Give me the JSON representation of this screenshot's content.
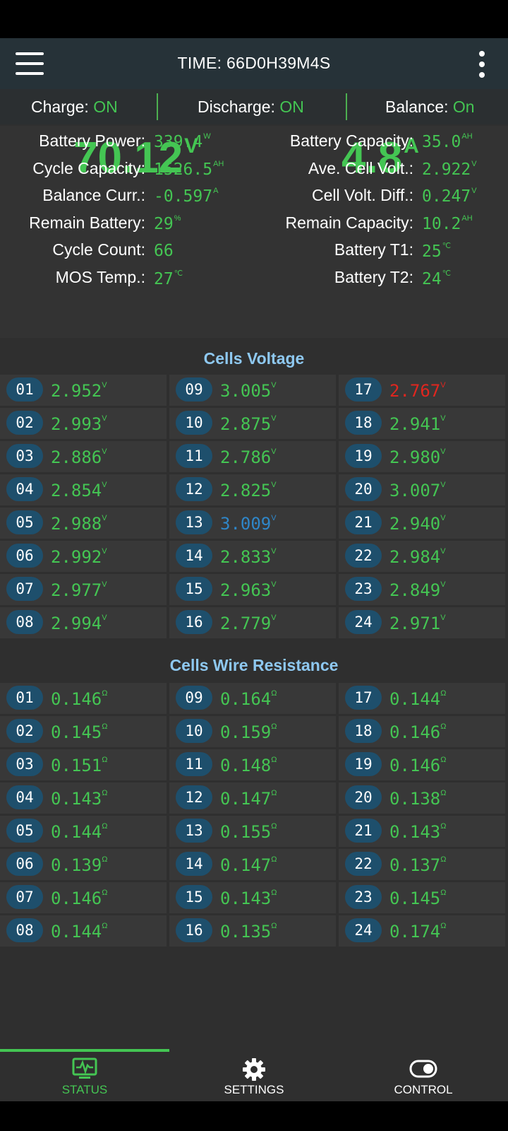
{
  "header": {
    "title": "TIME: 66D0H39M4S"
  },
  "switches": [
    {
      "label": "Charge:",
      "value": "ON"
    },
    {
      "label": "Discharge:",
      "value": "ON"
    },
    {
      "label": "Balance:",
      "value": "On"
    }
  ],
  "summary": {
    "voltage": {
      "value": "70.12",
      "unit": "V"
    },
    "current": {
      "value": "4.8",
      "unit": "A"
    },
    "left": [
      {
        "label": "Battery Power:",
        "value": "339.4",
        "unit": "W"
      },
      {
        "label": "Cycle Capacity:",
        "value": "1526.5",
        "unit": "AH"
      },
      {
        "label": "Balance Curr.:",
        "value": "-0.597",
        "unit": "A"
      },
      {
        "label": "Remain Battery:",
        "value": "29",
        "unit": "%"
      },
      {
        "label": "Cycle Count:",
        "value": "66",
        "unit": ""
      },
      {
        "label": "MOS Temp.:",
        "value": "27",
        "unit": "℃"
      }
    ],
    "right": [
      {
        "label": "Battery Capacity:",
        "value": "35.0",
        "unit": "AH"
      },
      {
        "label": "Ave. Cell Volt.:",
        "value": "2.922",
        "unit": "V"
      },
      {
        "label": "Cell Volt. Diff.:",
        "value": "0.247",
        "unit": "V"
      },
      {
        "label": "Remain Capacity:",
        "value": "10.2",
        "unit": "AH"
      },
      {
        "label": "Battery T1:",
        "value": "25",
        "unit": "℃"
      },
      {
        "label": "Battery T2:",
        "value": "24",
        "unit": "℃"
      }
    ]
  },
  "cells_voltage": {
    "title": "Cells Voltage",
    "unit": "V",
    "cells": [
      {
        "id": "01",
        "value": "2.952"
      },
      {
        "id": "02",
        "value": "2.993"
      },
      {
        "id": "03",
        "value": "2.886"
      },
      {
        "id": "04",
        "value": "2.854"
      },
      {
        "id": "05",
        "value": "2.988"
      },
      {
        "id": "06",
        "value": "2.992"
      },
      {
        "id": "07",
        "value": "2.977"
      },
      {
        "id": "08",
        "value": "2.994"
      },
      {
        "id": "09",
        "value": "3.005"
      },
      {
        "id": "10",
        "value": "2.875"
      },
      {
        "id": "11",
        "value": "2.786"
      },
      {
        "id": "12",
        "value": "2.825"
      },
      {
        "id": "13",
        "value": "3.009",
        "state": "high"
      },
      {
        "id": "14",
        "value": "2.833"
      },
      {
        "id": "15",
        "value": "2.963"
      },
      {
        "id": "16",
        "value": "2.779"
      },
      {
        "id": "17",
        "value": "2.767",
        "state": "low"
      },
      {
        "id": "18",
        "value": "2.941"
      },
      {
        "id": "19",
        "value": "2.980"
      },
      {
        "id": "20",
        "value": "3.007"
      },
      {
        "id": "21",
        "value": "2.940"
      },
      {
        "id": "22",
        "value": "2.984"
      },
      {
        "id": "23",
        "value": "2.849"
      },
      {
        "id": "24",
        "value": "2.971"
      }
    ]
  },
  "cells_resistance": {
    "title": "Cells Wire Resistance",
    "unit": "Ω",
    "cells": [
      {
        "id": "01",
        "value": "0.146"
      },
      {
        "id": "02",
        "value": "0.145"
      },
      {
        "id": "03",
        "value": "0.151"
      },
      {
        "id": "04",
        "value": "0.143"
      },
      {
        "id": "05",
        "value": "0.144"
      },
      {
        "id": "06",
        "value": "0.139"
      },
      {
        "id": "07",
        "value": "0.146"
      },
      {
        "id": "08",
        "value": "0.144"
      },
      {
        "id": "09",
        "value": "0.164"
      },
      {
        "id": "10",
        "value": "0.159"
      },
      {
        "id": "11",
        "value": "0.148"
      },
      {
        "id": "12",
        "value": "0.147"
      },
      {
        "id": "13",
        "value": "0.155"
      },
      {
        "id": "14",
        "value": "0.147"
      },
      {
        "id": "15",
        "value": "0.143"
      },
      {
        "id": "16",
        "value": "0.135"
      },
      {
        "id": "17",
        "value": "0.144"
      },
      {
        "id": "18",
        "value": "0.146"
      },
      {
        "id": "19",
        "value": "0.146"
      },
      {
        "id": "20",
        "value": "0.138"
      },
      {
        "id": "21",
        "value": "0.143"
      },
      {
        "id": "22",
        "value": "0.137"
      },
      {
        "id": "23",
        "value": "0.145"
      },
      {
        "id": "24",
        "value": "0.174"
      }
    ]
  },
  "nav": {
    "items": [
      {
        "label": "STATUS",
        "icon": "status-monitor-icon",
        "active": true
      },
      {
        "label": "SETTINGS",
        "icon": "gear-icon",
        "active": false
      },
      {
        "label": "CONTROL",
        "icon": "toggle-icon",
        "active": false
      }
    ]
  },
  "colors": {
    "accent_green": "#44c553",
    "low_red": "#e0261f",
    "high_blue": "#2f86c8",
    "badge_blue": "#1e4f6c",
    "section_title": "#8ec8f0"
  }
}
